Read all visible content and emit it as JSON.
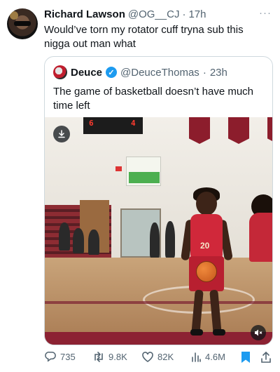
{
  "tweet": {
    "author_name": "Richard Lawson",
    "author_handle": "@OG__CJ",
    "separator": "·",
    "time": "17h",
    "text": "Would’ve torn my rotator cuff tryna sub this nigga out man what",
    "more_icon": "more-dots-icon"
  },
  "quote": {
    "author_name": "Deuce",
    "verified_mark": "✓",
    "author_handle": "@DeuceThomas",
    "separator": "·",
    "time": "23h",
    "text": "The game of basketball doesn’t have much time left",
    "scoreboard": {
      "home": "6",
      "away": "4"
    },
    "jersey_number": "20"
  },
  "actions": {
    "replies": "735",
    "reposts": "9.8K",
    "likes": "82K",
    "views": "4.6M"
  },
  "colors": {
    "accent": "#1d9bf0",
    "muted_text": "#536471",
    "border": "#cfd9de",
    "jersey": "#d0283a"
  }
}
